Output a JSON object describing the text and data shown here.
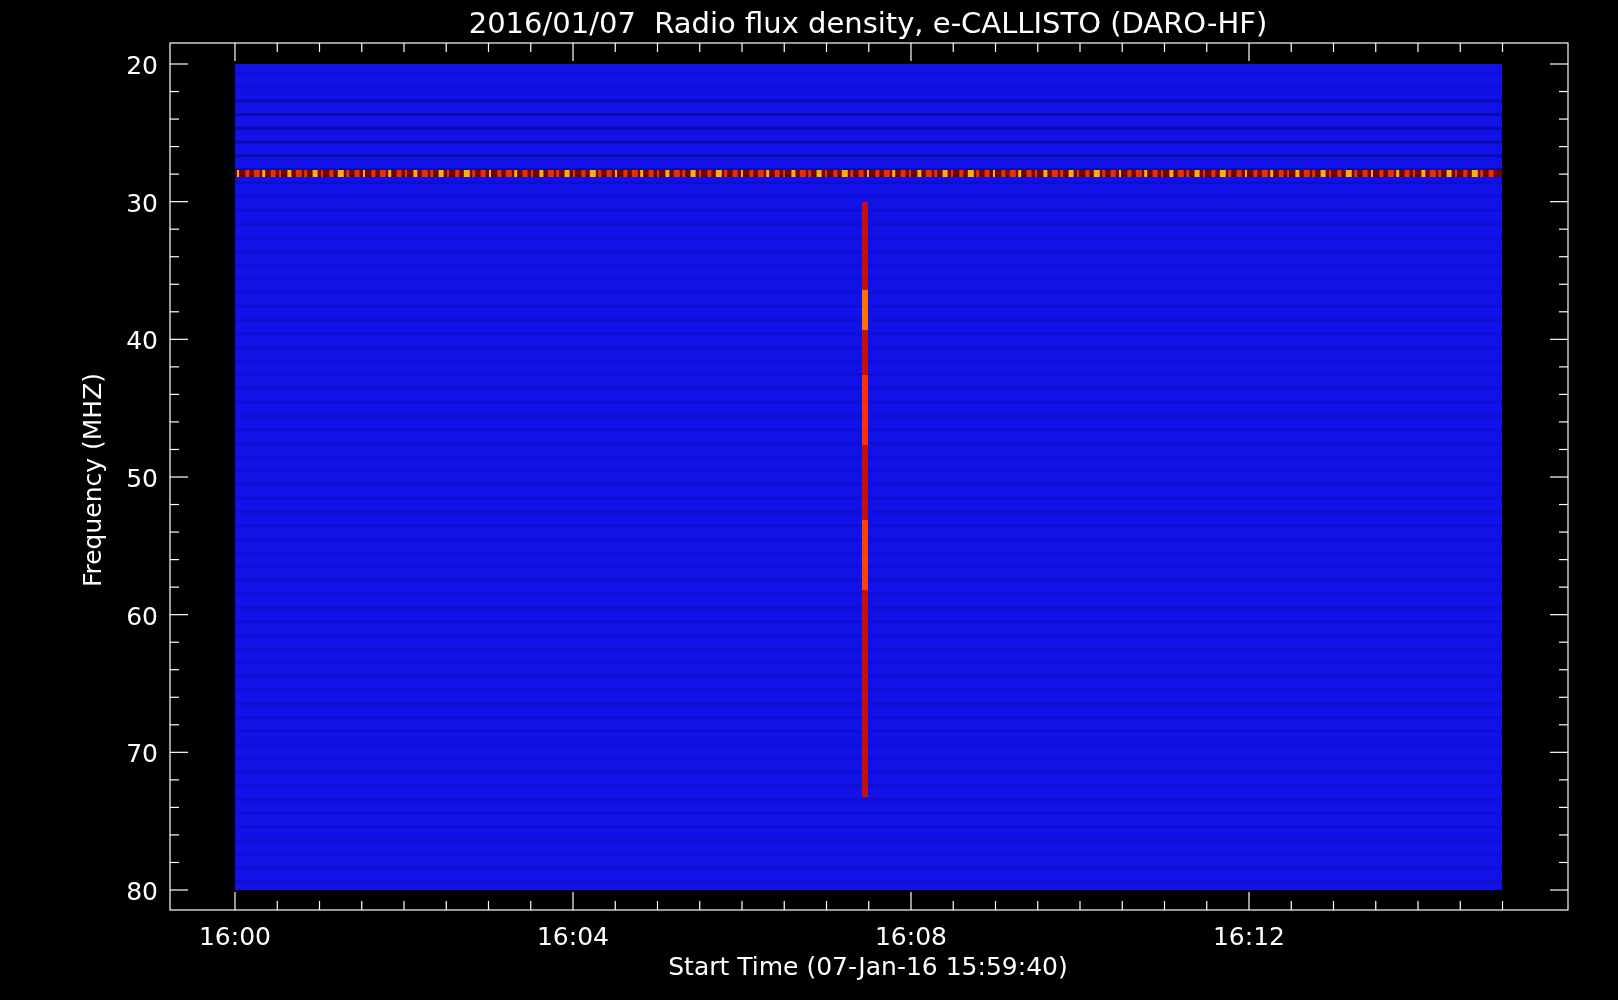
{
  "title": "2016/01/07  Radio flux density, e-CALLISTO (DARO-HF)",
  "y_axis": {
    "label": "Frequency (MHZ)",
    "ticks": [
      "20",
      "30",
      "40",
      "50",
      "60",
      "70",
      "80"
    ]
  },
  "x_axis": {
    "label": "Start Time (07-Jan-16 15:59:40)",
    "ticks": [
      "16:00",
      "16:04",
      "16:08",
      "16:12"
    ]
  }
}
